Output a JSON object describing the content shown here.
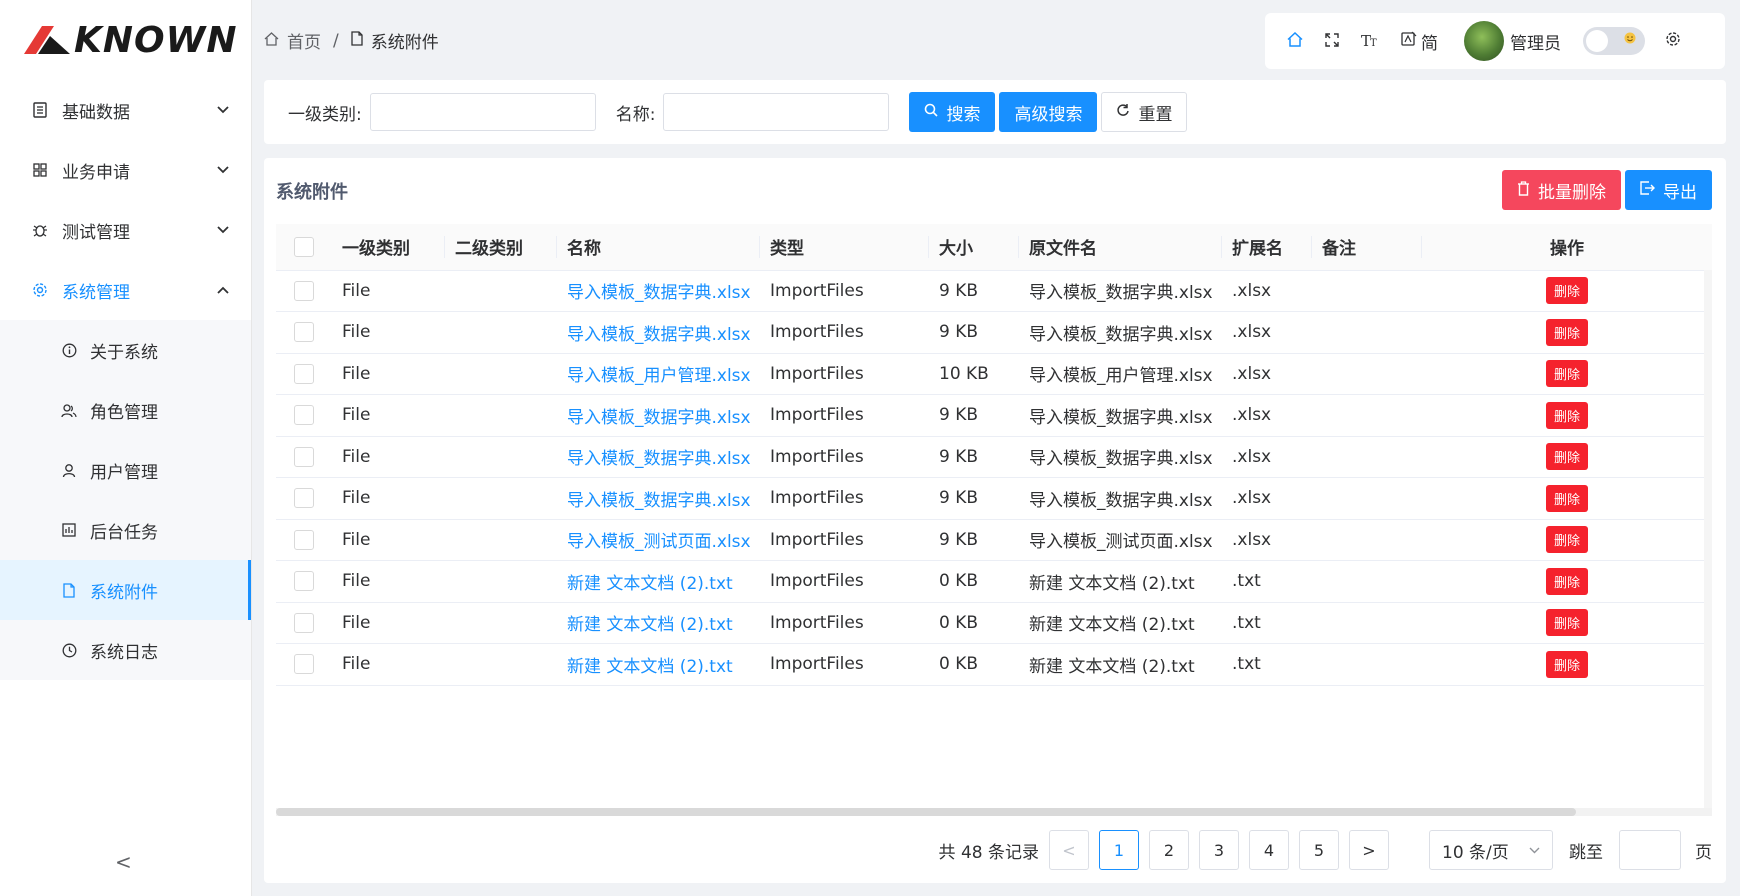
{
  "logo": {
    "text": "KNOWN"
  },
  "sidebar": {
    "items": [
      {
        "label": "基础数据",
        "icon": "list-icon",
        "chevron": "⌄"
      },
      {
        "label": "业务申请",
        "icon": "grid-icon",
        "chevron": "⌄"
      },
      {
        "label": "测试管理",
        "icon": "bug-icon",
        "chevron": "⌄"
      },
      {
        "label": "系统管理",
        "icon": "gear-icon",
        "chevron": "⌃"
      }
    ],
    "sub_items": [
      {
        "label": "关于系统",
        "icon": "info-icon"
      },
      {
        "label": "角色管理",
        "icon": "role-icon"
      },
      {
        "label": "用户管理",
        "icon": "user-icon"
      },
      {
        "label": "后台任务",
        "icon": "task-icon"
      },
      {
        "label": "系统附件",
        "icon": "file-icon"
      },
      {
        "label": "系统日志",
        "icon": "clock-icon"
      }
    ],
    "collapse": "<"
  },
  "breadcrumb": {
    "home": "首页",
    "sep": "/",
    "current": "系统附件"
  },
  "toolbar": {
    "lang": "简",
    "username": "管理员"
  },
  "search": {
    "category_label": "一级类别:",
    "category_value": "",
    "name_label": "名称:",
    "name_value": "",
    "search_btn": "搜索",
    "advanced_btn": "高级搜索",
    "reset_btn": "重置"
  },
  "card": {
    "title": "系统附件",
    "batch_delete": "批量删除",
    "export": "导出"
  },
  "table": {
    "columns": [
      "一级类别",
      "二级类别",
      "名称",
      "类型",
      "大小",
      "原文件名",
      "扩展名",
      "备注",
      "操作"
    ],
    "delete_label": "删除",
    "rows": [
      {
        "c1": "File",
        "c2": "",
        "name": "导入模板_数据字典.xlsx",
        "type": "ImportFiles",
        "size": "9 KB",
        "orig": "导入模板_数据字典.xlsx",
        "ext": ".xlsx",
        "note": ""
      },
      {
        "c1": "File",
        "c2": "",
        "name": "导入模板_数据字典.xlsx",
        "type": "ImportFiles",
        "size": "9 KB",
        "orig": "导入模板_数据字典.xlsx",
        "ext": ".xlsx",
        "note": ""
      },
      {
        "c1": "File",
        "c2": "",
        "name": "导入模板_用户管理.xlsx",
        "type": "ImportFiles",
        "size": "10 KB",
        "orig": "导入模板_用户管理.xlsx",
        "ext": ".xlsx",
        "note": ""
      },
      {
        "c1": "File",
        "c2": "",
        "name": "导入模板_数据字典.xlsx",
        "type": "ImportFiles",
        "size": "9 KB",
        "orig": "导入模板_数据字典.xlsx",
        "ext": ".xlsx",
        "note": ""
      },
      {
        "c1": "File",
        "c2": "",
        "name": "导入模板_数据字典.xlsx",
        "type": "ImportFiles",
        "size": "9 KB",
        "orig": "导入模板_数据字典.xlsx",
        "ext": ".xlsx",
        "note": ""
      },
      {
        "c1": "File",
        "c2": "",
        "name": "导入模板_数据字典.xlsx",
        "type": "ImportFiles",
        "size": "9 KB",
        "orig": "导入模板_数据字典.xlsx",
        "ext": ".xlsx",
        "note": ""
      },
      {
        "c1": "File",
        "c2": "",
        "name": "导入模板_测试页面.xlsx",
        "type": "ImportFiles",
        "size": "9 KB",
        "orig": "导入模板_测试页面.xlsx",
        "ext": ".xlsx",
        "note": ""
      },
      {
        "c1": "File",
        "c2": "",
        "name": "新建 文本文档 (2).txt",
        "type": "ImportFiles",
        "size": "0 KB",
        "orig": "新建 文本文档 (2).txt",
        "ext": ".txt",
        "note": ""
      },
      {
        "c1": "File",
        "c2": "",
        "name": "新建 文本文档 (2).txt",
        "type": "ImportFiles",
        "size": "0 KB",
        "orig": "新建 文本文档 (2).txt",
        "ext": ".txt",
        "note": ""
      },
      {
        "c1": "File",
        "c2": "",
        "name": "新建 文本文档 (2).txt",
        "type": "ImportFiles",
        "size": "0 KB",
        "orig": "新建 文本文档 (2).txt",
        "ext": ".txt",
        "note": ""
      }
    ]
  },
  "pagination": {
    "total_text": "共 48 条记录",
    "prev": "<",
    "next": ">",
    "pages": [
      "1",
      "2",
      "3",
      "4",
      "5"
    ],
    "current": "1",
    "page_size": "10 条/页",
    "jump_label": "跳至",
    "jump_suffix": "页",
    "jump_value": ""
  },
  "colors": {
    "primary": "#1890ff",
    "danger": "#f5222d",
    "batch_delete": "#f5475d"
  }
}
